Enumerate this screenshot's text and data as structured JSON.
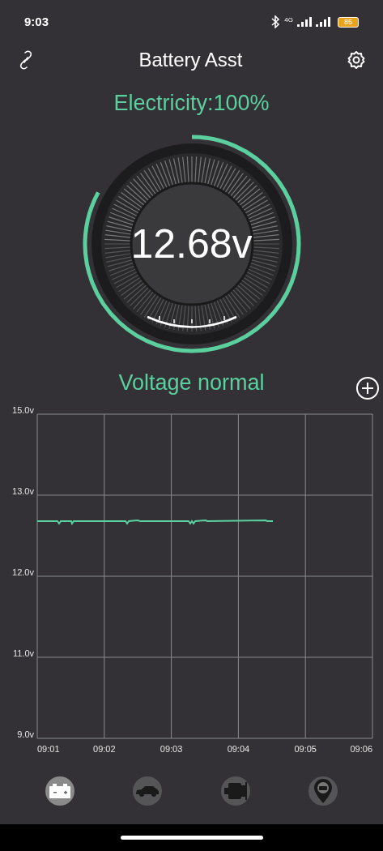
{
  "status_bar": {
    "time": "9:03",
    "network": "4G",
    "battery": "85"
  },
  "header": {
    "title": "Battery Asst"
  },
  "electricity": {
    "label": "Electricity:100%"
  },
  "gauge": {
    "reading": "12.68v"
  },
  "status": {
    "text": "Voltage normal"
  },
  "chart": {
    "y_labels": [
      "15.0v",
      "13.0v",
      "12.0v",
      "11.0v",
      "9.0v"
    ],
    "x_labels": [
      "09:01",
      "09:02",
      "09:03",
      "09:04",
      "09:05",
      "09:06"
    ]
  },
  "nav": [
    {
      "kind": "battery",
      "selected": true
    },
    {
      "kind": "car",
      "selected": false
    },
    {
      "kind": "engine",
      "selected": false
    },
    {
      "kind": "location",
      "selected": false
    }
  ]
}
